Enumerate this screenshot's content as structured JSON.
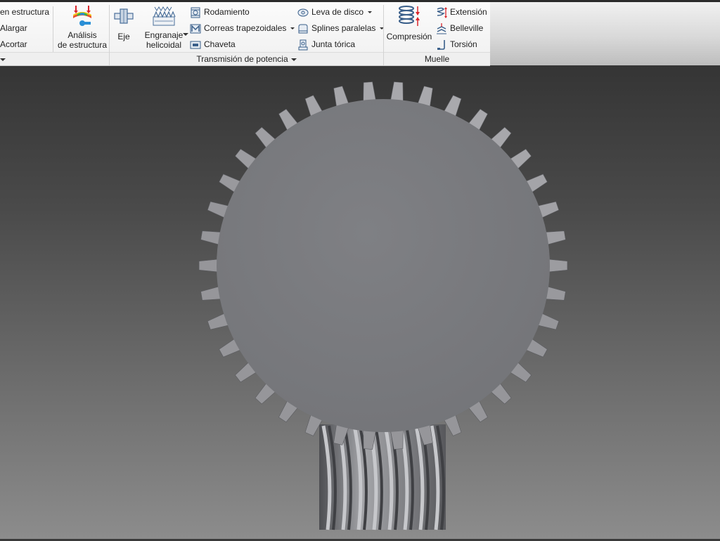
{
  "ribbon": {
    "structure_panel": {
      "items": [
        "en estructura",
        "Alargar",
        "Acortar"
      ],
      "analysis_button": [
        "Análisis",
        "de estructura"
      ]
    },
    "power_transmission": {
      "title": "Transmisión de potencia",
      "shaft_button": "Eje",
      "worm_gear_button": [
        "Engranaje",
        "helicoidal"
      ],
      "column1": [
        "Rodamiento",
        "Correas trapezoidales",
        "Chaveta"
      ],
      "column2": [
        "Leva de disco",
        "Splines paralelas",
        "Junta tórica"
      ]
    },
    "spring": {
      "title": "Muelle",
      "compression_button": "Compresión",
      "items": [
        "Extensión",
        "Belleville",
        "Torsión"
      ]
    }
  },
  "colors": {
    "gear_face": "#7c7d81",
    "gear_tooth": "#9fa0a4",
    "worm": "#8d8e92",
    "viewport_top": "#353535",
    "viewport_bottom": "#8c8c8c"
  }
}
